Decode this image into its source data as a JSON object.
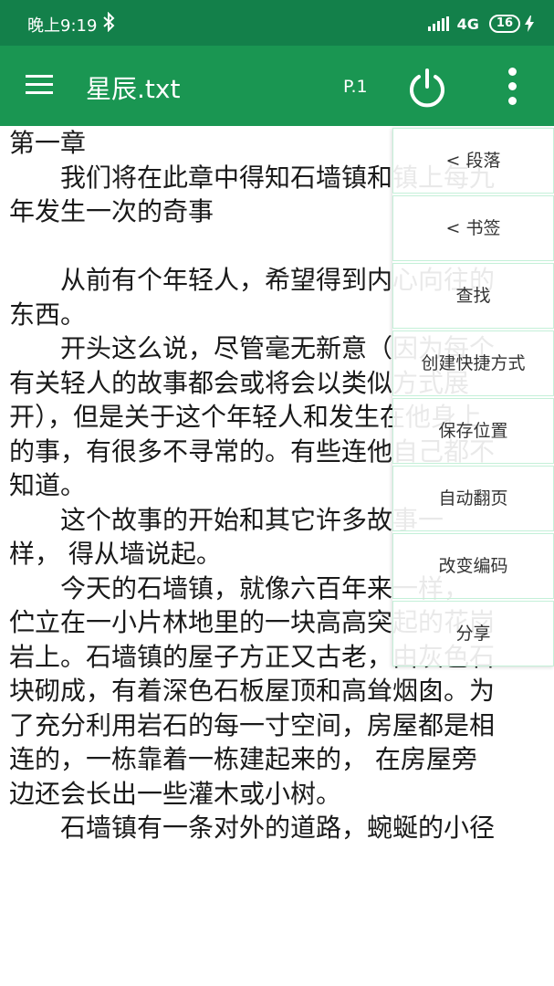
{
  "status_bar": {
    "time": "晚上9:19",
    "network": "4G",
    "battery": "16",
    "bg_color": "#13804a"
  },
  "app_bar": {
    "title": "星辰.txt",
    "page": "P.1",
    "bg_color": "#1a9652",
    "icons": [
      "menu-icon",
      "power-icon",
      "more-vert-icon"
    ]
  },
  "reader": {
    "lines": [
      "第一章",
      "　　我们将在此章中得知石墙镇和镇上每九",
      "年发生一次的奇事",
      "",
      "　　从前有个年轻人，希望得到内心向往的",
      "东西。",
      "　　开头这么说，尽管毫无新意（因为每个",
      "有关轻人的故事都会或将会以类似方式展",
      "开），但是关于这个年轻人和发生在他身上",
      "的事，有很多不寻常的。有些连他自己都不",
      "知道。",
      "　　这个故事的开始和其它许多故事一",
      "样， 得从墙说起。",
      "　　今天的石墙镇，就像六百年来一样，",
      "伫立在一小片林地里的一块高高突起的花岗",
      "岩上。石墙镇的屋子方正又古老，由灰色石",
      "块砌成，有着深色石板屋顶和高耸烟囱。为",
      "了充分利用岩石的每一寸空间，房屋都是相",
      "连的，一栋靠着一栋建起来的， 在房屋旁",
      "边还会长出一些灌木或小树。",
      "　　石墙镇有一条对外的道路，蜿蜒的小径"
    ]
  },
  "menu": {
    "items": [
      {
        "label": "< 段落"
      },
      {
        "label": "< 书签"
      },
      {
        "label": "查找"
      },
      {
        "label": "创建快捷方式"
      },
      {
        "label": "保存位置"
      },
      {
        "label": "自动翻页"
      },
      {
        "label": "改变编码"
      },
      {
        "label": "分享"
      }
    ],
    "border_color": "#c4f0d8"
  }
}
